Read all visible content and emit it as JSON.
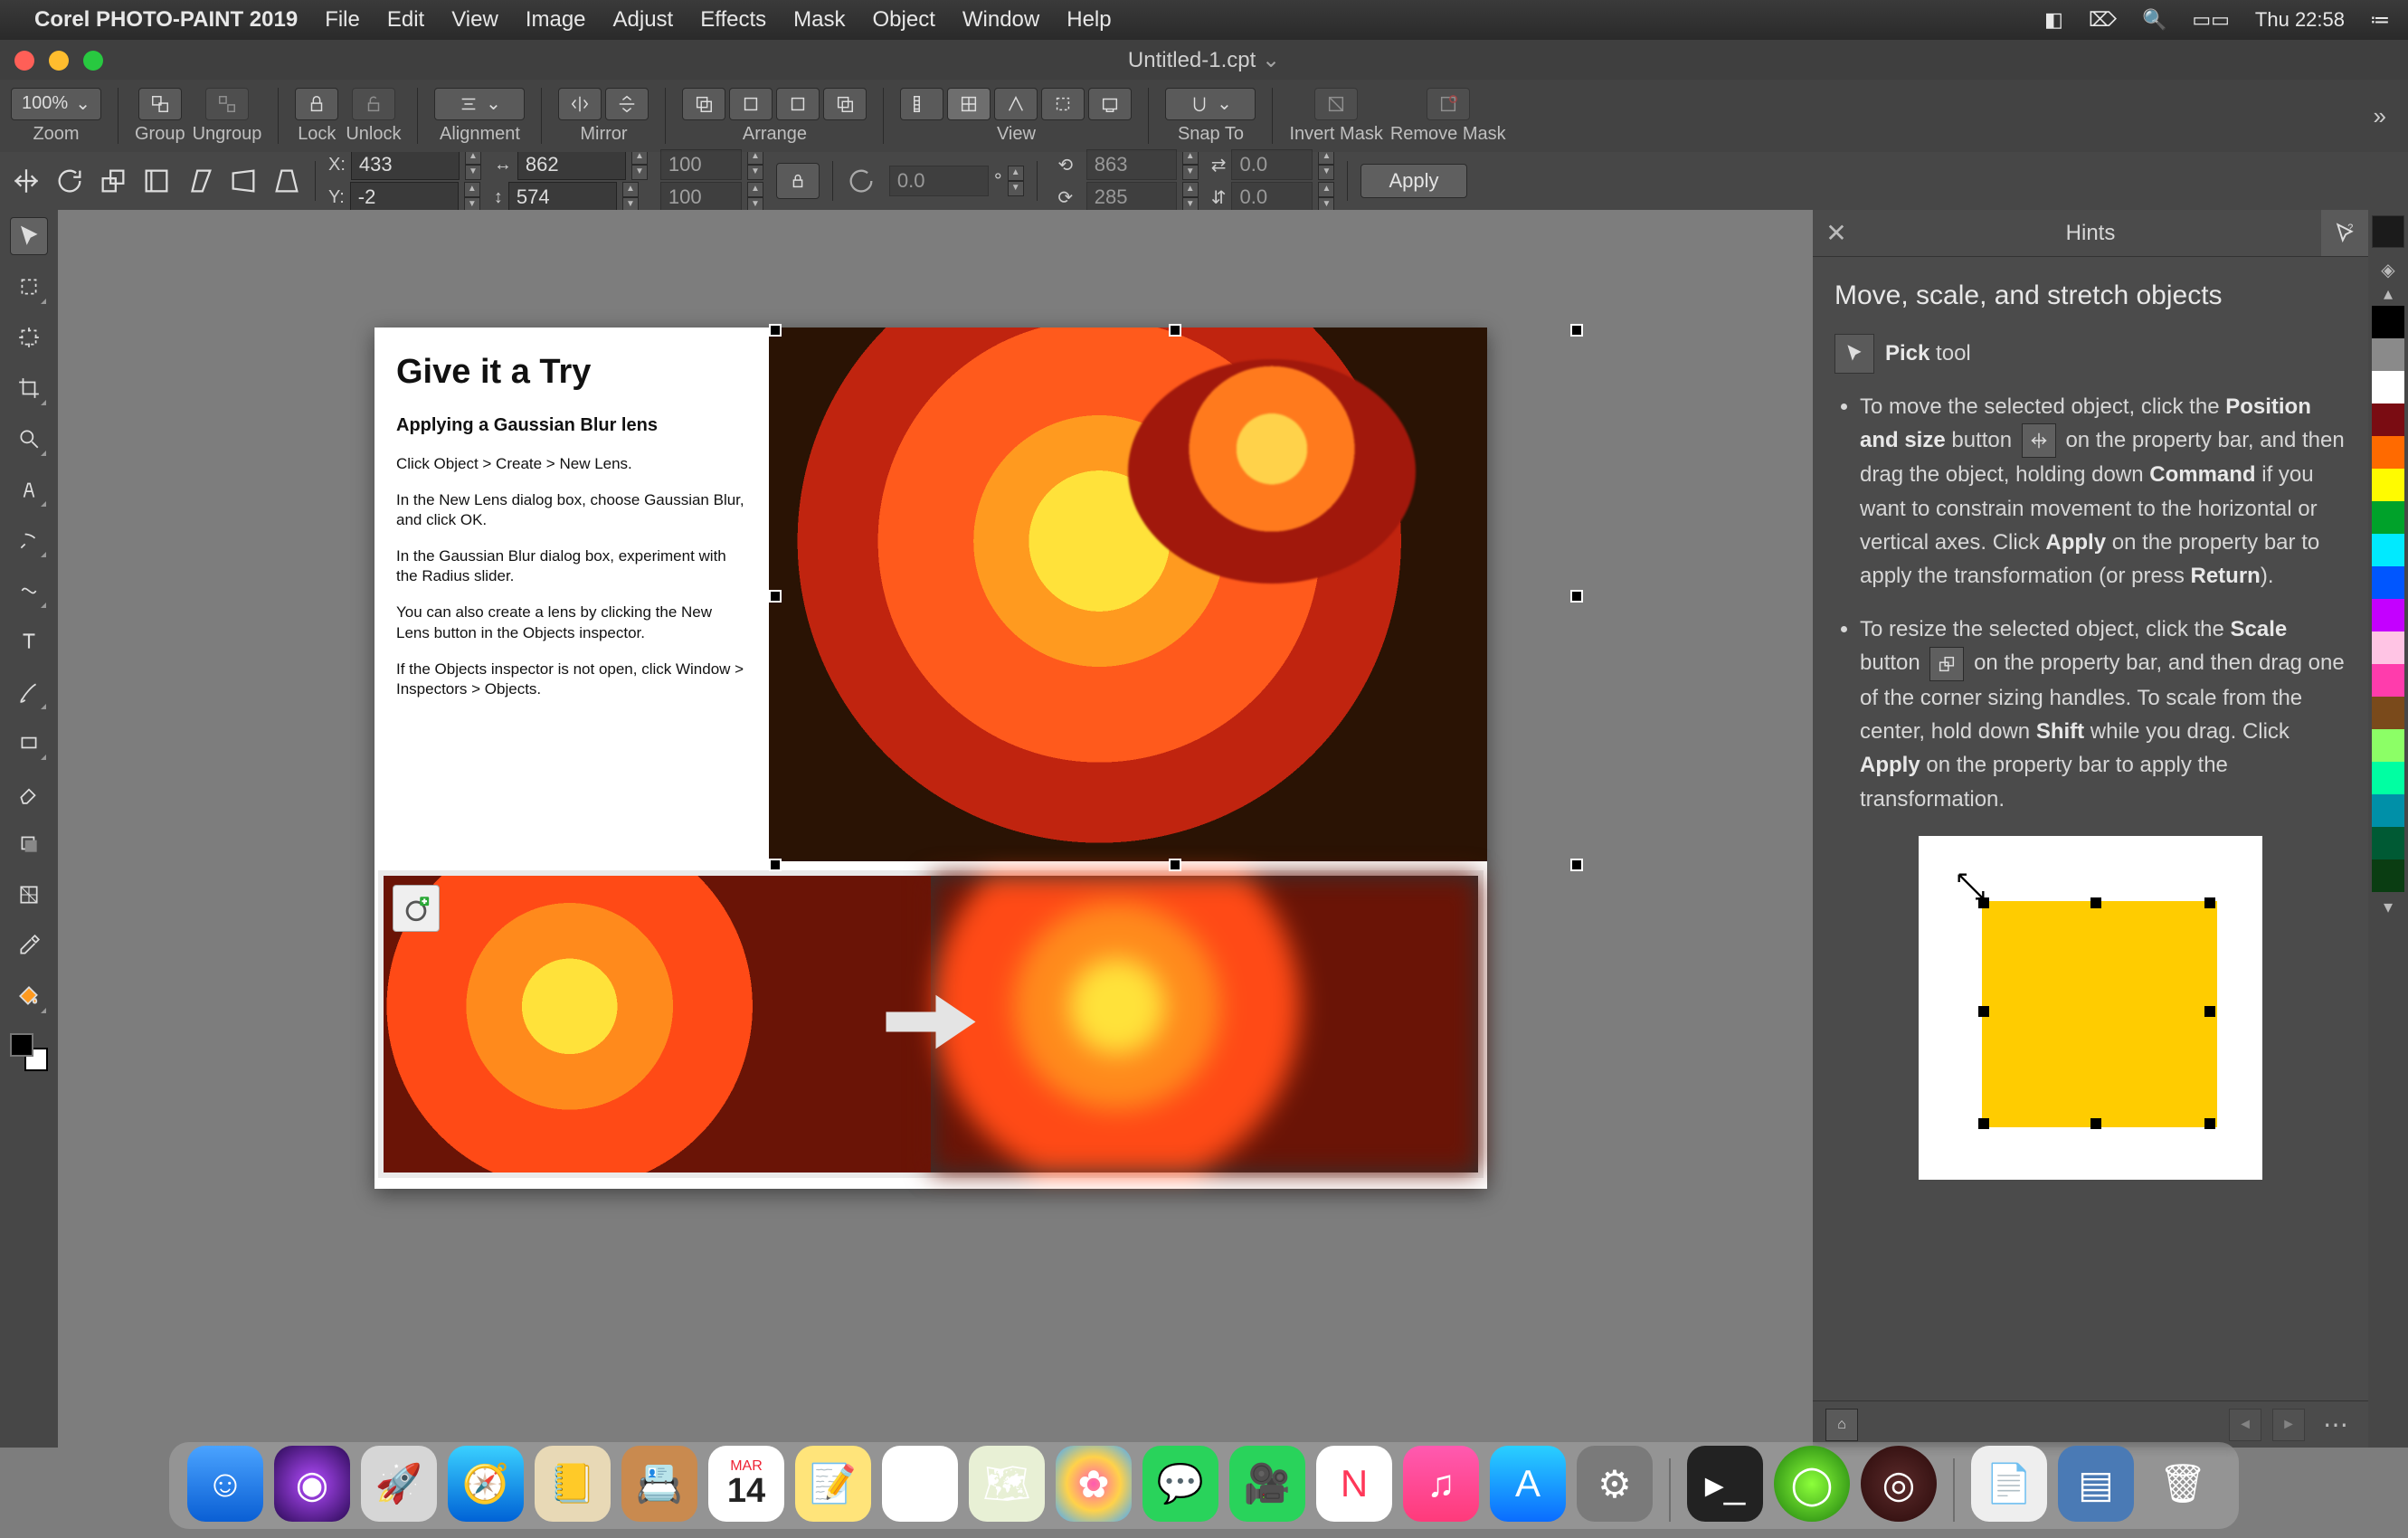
{
  "menubar": {
    "app": "Corel PHOTO-PAINT 2019",
    "items": [
      "File",
      "Edit",
      "View",
      "Image",
      "Adjust",
      "Effects",
      "Mask",
      "Object",
      "Window",
      "Help"
    ],
    "clock": "Thu 22:58"
  },
  "window": {
    "title": "Untitled-1.cpt"
  },
  "toolbar1": {
    "zoom": "100%",
    "groups": {
      "group": "Group",
      "ungroup": "Ungroup",
      "lock": "Lock",
      "unlock": "Unlock",
      "alignment": "Alignment",
      "mirror": "Mirror",
      "arrange": "Arrange",
      "view": "View",
      "snapto": "Snap To",
      "invertmask": "Invert Mask",
      "removemask": "Remove Mask"
    }
  },
  "toolbar2": {
    "x": "433",
    "y": "-2",
    "w": "862",
    "h": "574",
    "sx": "100",
    "sy": "100",
    "rot": "0.0",
    "cx": "863",
    "cy": "285",
    "skx": "0.0",
    "sky": "0.0",
    "apply": "Apply"
  },
  "hints": {
    "title": "Hints",
    "heading": "Move, scale, and stretch objects",
    "toolname": "Pick",
    "toolword": "tool",
    "li1a": "To move the selected object, click the ",
    "li1b": "Position and size",
    "li1c": " button ",
    "li1d": " on the property bar, and then drag the object, holding down ",
    "li1e": "Command",
    "li1f": " if you want to constrain movement to the horizontal or vertical axes. Click ",
    "li1g": "Apply",
    "li1h": " on the property bar to apply the transformation (or press ",
    "li1i": "Return",
    "li1j": ").",
    "li2a": "To resize the selected object, click the ",
    "li2b": "Scale",
    "li2c": " button ",
    "li2d": " on the property bar, and then drag one of the corner sizing handles. To scale from the center, hold down ",
    "li2e": "Shift",
    "li2f": " while you drag. Click ",
    "li2g": "Apply",
    "li2h": " on the property bar to apply the transformation."
  },
  "docpane": {
    "title": "Give it a Try",
    "sub": "Applying a Gaussian Blur lens",
    "p1": "Click Object > Create > New Lens.",
    "p2": "In the New Lens dialog box, choose Gaussian Blur, and click OK.",
    "p3": "In the Gaussian Blur dialog box, experiment with the Radius slider.",
    "p4": "You can also create a lens by clicking the New Lens button in the Objects inspector.",
    "p5": "If the Objects inspector is not open, click Window > Inspectors > Objects."
  },
  "palette": [
    "#000000",
    "#8a8a8a",
    "#ffffff",
    "#7a0c12",
    "#ff6a00",
    "#fffb00",
    "#00a22a",
    "#00eaff",
    "#0056ff",
    "#c400ff",
    "#ffc4e4",
    "#ff3cac",
    "#7a4a1b",
    "#8cff66",
    "#00ffa2",
    "#0090a8",
    "#005a34",
    "#0a3d12"
  ]
}
